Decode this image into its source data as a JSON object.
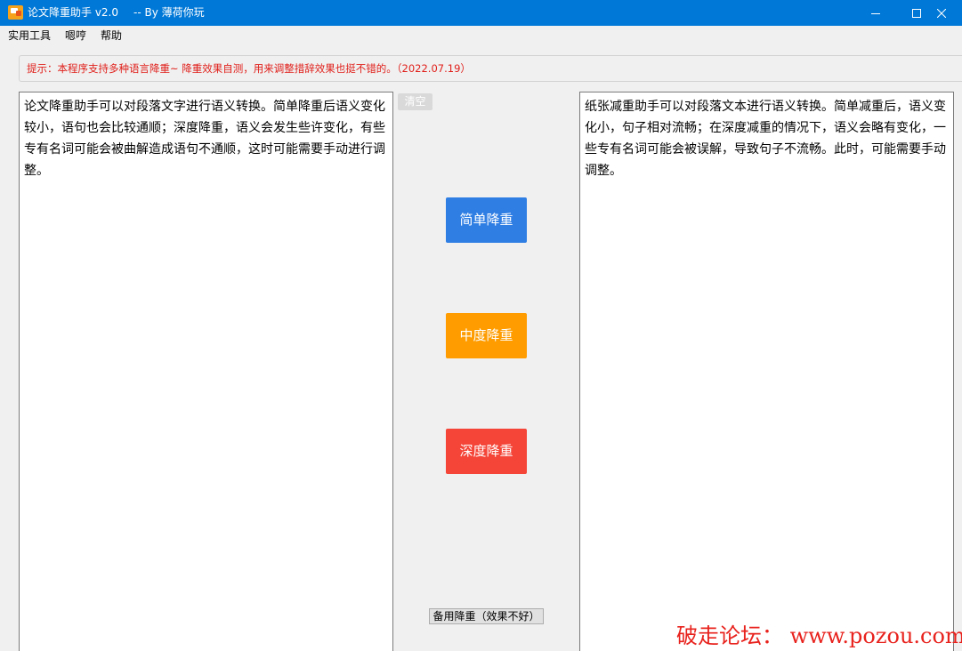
{
  "window": {
    "title": "论文降重助手 v2.0",
    "author": "-- By 薄荷你玩"
  },
  "menu": [
    "实用工具",
    "嗯哼",
    "帮助"
  ],
  "tip": "提示：本程序支持多种语言降重~  降重效果自测，用来调整措辞效果也挺不错的。（2022.07.19）",
  "input_text": "论文降重助手可以对段落文字进行语义转换。简单降重后语义变化较小，语句也会比较通顺；深度降重，语义会发生些许变化，有些专有名词可能会被曲解造成语句不通顺，这时可能需要手动进行调整。",
  "output_text": "纸张减重助手可以对段落文本进行语义转换。简单减重后，语义变化小，句子相对流畅；在深度减重的情况下，语义会略有变化，一些专有名词可能会被误解，导致句子不流畅。此时，可能需要手动调整。",
  "buttons": {
    "clear": "清空",
    "simple": "简单降重",
    "medium": "中度降重",
    "deep": "深度降重",
    "backup": "备用降重（效果不好）"
  },
  "watermark": "破走论坛： www.pozou.com",
  "colors": {
    "titlebar": "#0078d7",
    "simple": "#2f7ee4",
    "medium": "#fe9c00",
    "deep": "#f44538",
    "tip": "#e0201b"
  }
}
